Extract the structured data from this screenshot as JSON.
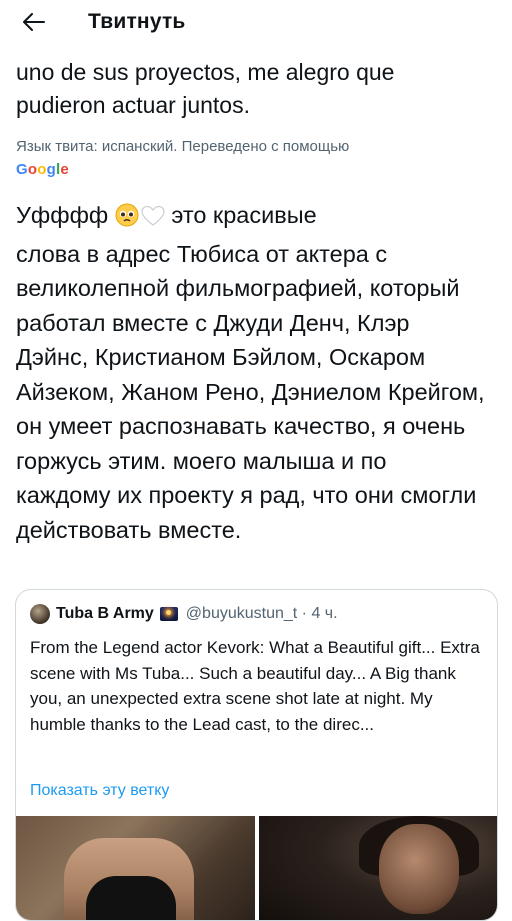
{
  "header": {
    "title": "Твитнуть",
    "back_icon": "arrow-left-icon"
  },
  "tweet": {
    "original_text": "uno de sus proyectos, me alegro que pudieron actuar juntos.",
    "translation_note": "Язык твита: испанский. Переведено с помощью",
    "translation_provider": "Google",
    "translated_line1": "Уфффф",
    "translated_line1_rest": " это красивые",
    "translated_rest": "слова в адрес Тюбиса от актера с великолепной фильмографией, который работал вместе с Джуди Денч, Клэр Дэйнс, Кристианом Бэйлом, Оскаром Айзеком, Жаном Рено, Дэниелом Крейгом, он умеет распознавать качество, я очень горжусь этим. моего малыша и по каждому их проекту я рад, что они смогли действовать вместе."
  },
  "quote": {
    "author_name": "Tuba B Army",
    "handle_time": "@buyukustun_t · 4 ч.",
    "text": "From the Legend actor Kevork: What a Beautiful gift... Extra scene with Ms Tuba... Such a beautiful day... A Big thank you, an unexpected extra scene shot late at night. My humble thanks to the Lead cast, to the direc...",
    "show_thread_label": "Показать эту ветку"
  },
  "colors": {
    "link": "#1d9bf0",
    "muted": "#536471",
    "text": "#0f1419",
    "border": "#cfd9de"
  }
}
